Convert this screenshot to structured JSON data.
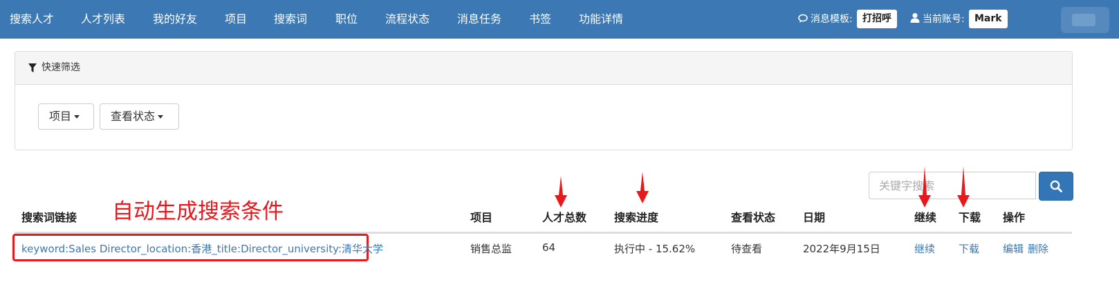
{
  "nav": {
    "items": [
      "搜索人才",
      "人才列表",
      "我的好友",
      "项目",
      "搜索词",
      "职位",
      "流程状态",
      "消息任务",
      "书签",
      "功能详情"
    ],
    "msg_template_label": "消息模板:",
    "msg_template_btn": "打招呼",
    "account_label": "当前账号:",
    "account_name": "Mark"
  },
  "filter": {
    "title": "快速筛选",
    "project_btn": "项目",
    "status_btn": "查看状态"
  },
  "search": {
    "placeholder": "关键字搜索"
  },
  "annotation": {
    "note": "自动生成搜索条件"
  },
  "table": {
    "headers": {
      "keyword": "搜索词链接",
      "project": "项目",
      "total": "人才总数",
      "progress": "搜索进度",
      "status": "查看状态",
      "date": "日期",
      "continue": "继续",
      "download": "下载",
      "ops": "操作"
    },
    "rows": [
      {
        "keyword": "keyword:Sales Director_location:香港_title:Director_university:清华大学",
        "project": "销售总监",
        "total": "64",
        "progress": "执行中 - 15.62%",
        "status": "待查看",
        "date": "2022年9月15日",
        "continue": "继续",
        "download": "下载",
        "edit": "编辑",
        "delete": "删除"
      }
    ]
  },
  "colors": {
    "navbar": "#3c78b4",
    "link": "#3c78b4",
    "annotation": "#e8191d"
  }
}
